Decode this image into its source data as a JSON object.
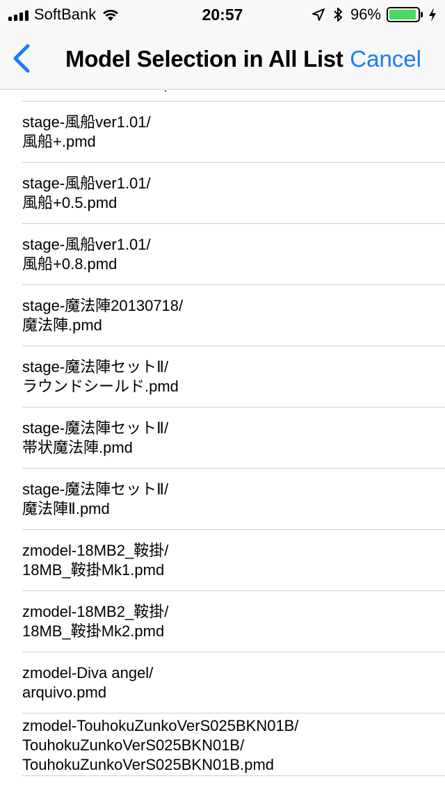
{
  "status_bar": {
    "carrier": "SoftBank",
    "time": "20:57",
    "battery_percent": "96%",
    "battery_level": 0.96,
    "icons": [
      "signal-icon",
      "wifi-icon",
      "location-icon",
      "bluetooth-icon",
      "battery-icon",
      "charging-icon"
    ]
  },
  "nav": {
    "title": "Model Selection in All List",
    "cancel_label": "Cancel",
    "accent_color": "#1a7bf5"
  },
  "items": [
    {
      "path": "stage-風船ver1.01/",
      "file": "風船+.pmd"
    },
    {
      "path": "stage-風船ver1.01/",
      "file": "風船+0.5.pmd"
    },
    {
      "path": "stage-風船ver1.01/",
      "file": "風船+0.8.pmd"
    },
    {
      "path": "stage-魔法陣20130718/",
      "file": "魔法陣.pmd"
    },
    {
      "path": "stage-魔法陣セットⅡ/",
      "file": "ラウンドシールド.pmd"
    },
    {
      "path": "stage-魔法陣セットⅡ/",
      "file": "帯状魔法陣.pmd"
    },
    {
      "path": "stage-魔法陣セットⅡ/",
      "file": "魔法陣Ⅱ.pmd"
    },
    {
      "path": "zmodel-18MB2_鞍掛/",
      "file": "18MB_鞍掛Mk1.pmd"
    },
    {
      "path": "zmodel-18MB2_鞍掛/",
      "file": "18MB_鞍掛Mk2.pmd"
    },
    {
      "path": "zmodel-Diva angel/",
      "file": "arquivo.pmd"
    },
    {
      "path": "zmodel-TouhokuZunkoVerS025BKN01B/",
      "path2": "TouhokuZunkoVerS025BKN01B/",
      "file": "TouhokuZunkoVerS025BKN01B.pmd"
    }
  ]
}
